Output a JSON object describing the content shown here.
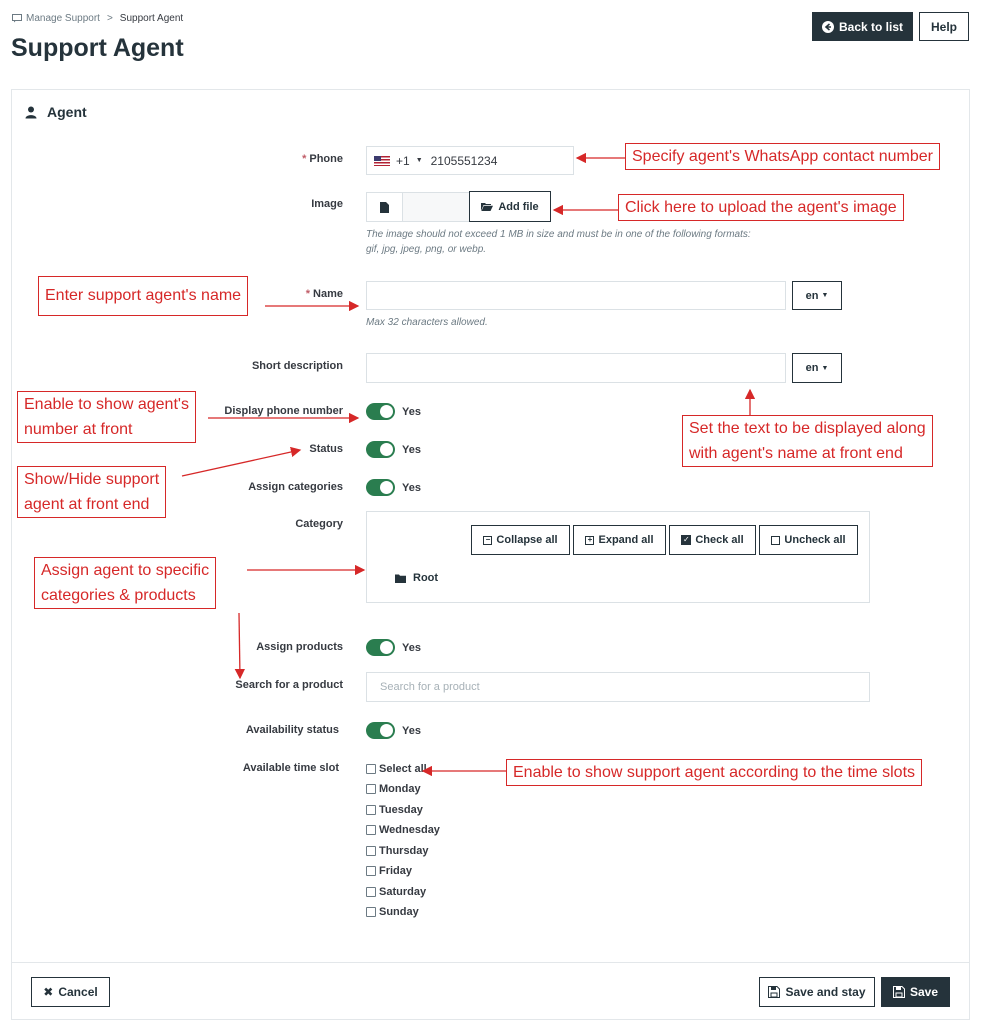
{
  "breadcrumb": {
    "parent": "Manage Support",
    "separator": ">",
    "current": "Support Agent"
  },
  "page_title": "Support Agent",
  "header_buttons": {
    "back": "Back to list",
    "help": "Help"
  },
  "section_title": "Agent",
  "form": {
    "phone": {
      "label": "Phone",
      "required_mark": "*",
      "country_code": "+1",
      "value": "2105551234"
    },
    "image": {
      "label": "Image",
      "add_file": "Add file",
      "hint": "The image should not exceed 1 MB in size and must be in one of the following formats: gif, jpg, jpeg, png, or webp."
    },
    "name": {
      "label": "Name",
      "required_mark": "*",
      "value": "",
      "lang": "en",
      "hint": "Max 32 characters allowed."
    },
    "short_description": {
      "label": "Short description",
      "value": "",
      "lang": "en"
    },
    "display_phone": {
      "label": "Display phone number",
      "state": "Yes"
    },
    "status": {
      "label": "Status",
      "state": "Yes"
    },
    "assign_categories": {
      "label": "Assign categories",
      "state": "Yes"
    },
    "category": {
      "label": "Category",
      "collapse_all": "Collapse all",
      "expand_all": "Expand all",
      "check_all": "Check all",
      "uncheck_all": "Uncheck all",
      "root": "Root"
    },
    "assign_products": {
      "label": "Assign products",
      "state": "Yes"
    },
    "search_product": {
      "label": "Search for a product",
      "placeholder": "Search for a product"
    },
    "availability_status": {
      "label": "Availability status",
      "state": "Yes"
    },
    "time_slot": {
      "label": "Available time slot",
      "options": [
        "Select all",
        "Monday",
        "Tuesday",
        "Wednesday",
        "Thursday",
        "Friday",
        "Saturday",
        "Sunday"
      ]
    }
  },
  "footer": {
    "cancel": "Cancel",
    "save_and_stay": "Save and stay",
    "save": "Save"
  },
  "annotations": {
    "phone": "Specify agent's WhatsApp contact number",
    "image": "Click here to upload the agent's image",
    "name": "Enter support agent's name",
    "display_phone_line1": "Enable to show agent's",
    "display_phone_line2": "number at front",
    "short_desc_line1": "Set the text to be displayed along",
    "short_desc_line2": "with agent's name at front end",
    "status_line1": "Show/Hide support",
    "status_line2": "agent at front end",
    "categories_line1": "Assign agent to specific",
    "categories_line2": "categories & products",
    "time_slots": "Enable to show support agent according to the time slots"
  },
  "colors": {
    "accent_green": "#2a7d4f",
    "dark": "#25333b",
    "annotation_red": "#d62828"
  }
}
